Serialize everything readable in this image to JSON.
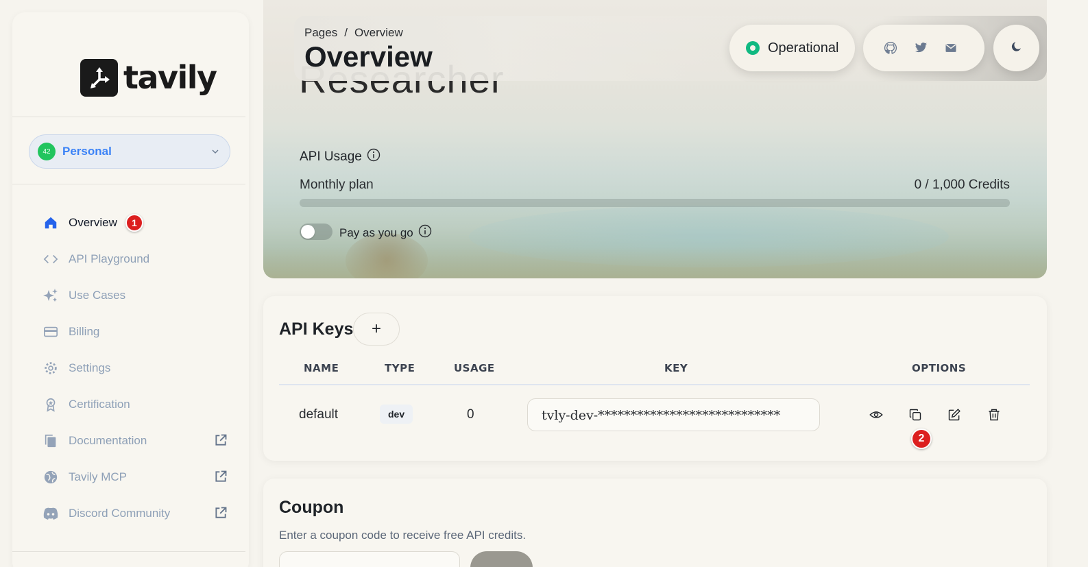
{
  "brand": {
    "name": "tavily"
  },
  "team": {
    "name": "Personal",
    "avatar_text": "42"
  },
  "nav": {
    "items": [
      {
        "label": "Overview",
        "icon": "home-icon",
        "active": true,
        "badge": "1"
      },
      {
        "label": "API Playground",
        "icon": "code-icon"
      },
      {
        "label": "Use Cases",
        "icon": "sparkles-icon"
      },
      {
        "label": "Billing",
        "icon": "credit-card-icon"
      },
      {
        "label": "Settings",
        "icon": "gear-icon"
      },
      {
        "label": "Certification",
        "icon": "award-icon"
      },
      {
        "label": "Documentation",
        "icon": "document-icon",
        "external": true
      },
      {
        "label": "Tavily MCP",
        "icon": "globe-icon",
        "external": true
      },
      {
        "label": "Discord Community",
        "icon": "discord-icon",
        "external": true
      }
    ]
  },
  "header": {
    "breadcrumb": [
      "Pages",
      "Overview"
    ],
    "breadcrumb_sep": "/",
    "title": "Overview",
    "status": "Operational",
    "social_icons": [
      "github-icon",
      "twitter-icon",
      "mail-icon"
    ],
    "theme_icon": "moon-icon"
  },
  "hero": {
    "plan_name": "Researcher",
    "usage_title": "API Usage",
    "plan_label": "Monthly plan",
    "credits": "0 / 1,000 Credits",
    "usage_fraction": 0,
    "payg_label": "Pay as you go",
    "payg_enabled": false
  },
  "api_keys": {
    "title": "API Keys",
    "add_label": "+",
    "columns": [
      "NAME",
      "TYPE",
      "USAGE",
      "KEY",
      "OPTIONS"
    ],
    "rows": [
      {
        "name": "default",
        "type": "dev",
        "usage": "0",
        "key": "tvly-dev-****************************",
        "badge": "2"
      }
    ],
    "option_icons": [
      "eye-icon",
      "copy-icon",
      "edit-icon",
      "trash-icon"
    ]
  },
  "coupon": {
    "title": "Coupon",
    "description": "Enter a coupon code to receive free API credits.",
    "placeholder": "",
    "button_label": ""
  },
  "colors": {
    "accent": "#3b82f6",
    "status_green": "#10b981",
    "badge_red": "#dc1f1f"
  }
}
